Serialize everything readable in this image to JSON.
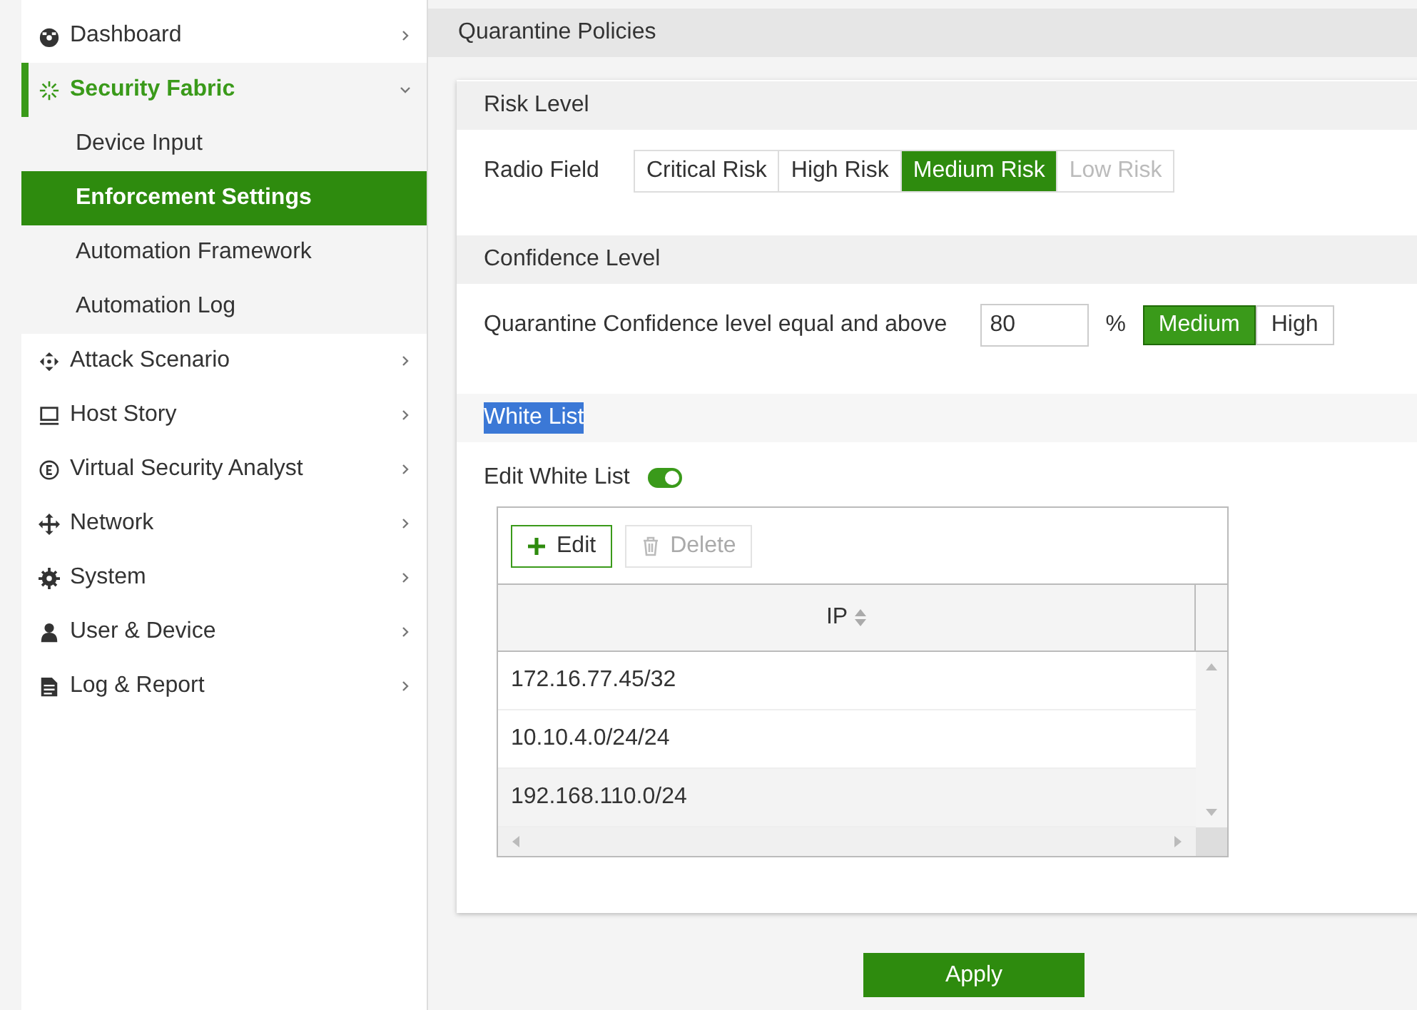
{
  "sidebar": {
    "items": [
      {
        "label": "Dashboard",
        "selected": false,
        "expanded": false
      },
      {
        "label": "Security Fabric",
        "selected": true,
        "expanded": true,
        "children": [
          {
            "label": "Device Input",
            "selected": false
          },
          {
            "label": "Enforcement Settings",
            "selected": true
          },
          {
            "label": "Automation Framework",
            "selected": false
          },
          {
            "label": "Automation Log",
            "selected": false
          }
        ]
      },
      {
        "label": "Attack Scenario",
        "selected": false,
        "expanded": false
      },
      {
        "label": "Host Story",
        "selected": false,
        "expanded": false
      },
      {
        "label": "Virtual Security Analyst",
        "selected": false,
        "expanded": false
      },
      {
        "label": "Network",
        "selected": false,
        "expanded": false
      },
      {
        "label": "System",
        "selected": false,
        "expanded": false
      },
      {
        "label": "User & Device",
        "selected": false,
        "expanded": false
      },
      {
        "label": "Log & Report",
        "selected": false,
        "expanded": false
      }
    ]
  },
  "page": {
    "title": "Quarantine Policies"
  },
  "risk_level": {
    "title": "Risk Level",
    "label": "Radio Field",
    "options": [
      {
        "label": "Critical Risk",
        "selected": false,
        "disabled": false
      },
      {
        "label": "High Risk",
        "selected": false,
        "disabled": false
      },
      {
        "label": "Medium Risk",
        "selected": true,
        "disabled": false
      },
      {
        "label": "Low Risk",
        "selected": false,
        "disabled": true
      }
    ]
  },
  "confidence_level": {
    "title": "Confidence Level",
    "label": "Quarantine Confidence level equal and above",
    "value": "80",
    "unit": "%",
    "options": [
      {
        "label": "Medium",
        "selected": true
      },
      {
        "label": "High",
        "selected": false
      }
    ]
  },
  "white_list": {
    "title": "White List",
    "highlighted": true,
    "toggle_label": "Edit White List",
    "toggle_on": true,
    "buttons": [
      {
        "label": "Edit",
        "disabled": false
      },
      {
        "label": "Delete",
        "disabled": true
      }
    ],
    "columns": [
      "IP"
    ],
    "rows": [
      {
        "ip": "172.16.77.45/32",
        "selected": false
      },
      {
        "ip": "10.10.4.0/24/24",
        "selected": false
      },
      {
        "ip": "192.168.110.0/24",
        "selected": true
      }
    ]
  },
  "apply_button": "Apply"
}
